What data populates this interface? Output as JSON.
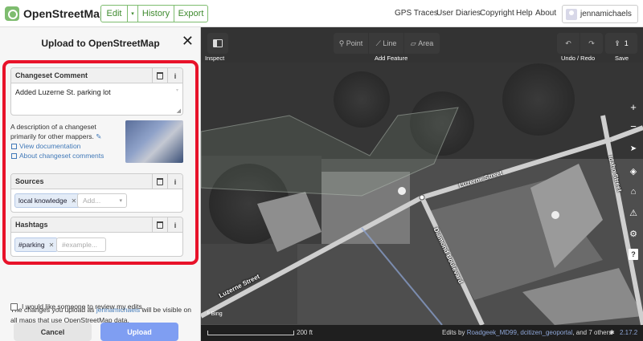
{
  "topbar": {
    "app_name": "OpenStreetMap",
    "edit_label": "Edit",
    "history_label": "History",
    "export_label": "Export",
    "nav": [
      "GPS Traces",
      "User Diaries",
      "Copyright",
      "Help",
      "About"
    ],
    "username": "jennamichaels"
  },
  "sidebar": {
    "title": "Upload to OpenStreetMap",
    "changeset_comment": {
      "label": "Changeset Comment",
      "value": "Added Luzerne St. parking lot"
    },
    "description": "A description of a changeset primarily for other mappers.",
    "links": [
      "View documentation",
      "About changeset comments"
    ],
    "sources": {
      "label": "Sources",
      "chips": [
        "local knowledge"
      ],
      "placeholder": "Add..."
    },
    "hashtags": {
      "label": "Hashtags",
      "chips": [
        "#parking"
      ],
      "placeholder": "#example..."
    },
    "notice_prefix": "The changes you upload as ",
    "notice_user": "jennamichaels",
    "notice_suffix": " will be visible on all maps that use OpenStreetMap data.",
    "review_label": "I would like someone to review my edits.",
    "cancel_label": "Cancel",
    "upload_label": "Upload"
  },
  "map": {
    "inspect_label": "Inspect",
    "point_label": "Point",
    "line_label": "Line",
    "area_label": "Area",
    "add_feature_label": "Add Feature",
    "undo_redo_label": "Undo / Redo",
    "save_label": "Save",
    "save_count": "1",
    "streets": [
      "Luzerne Street",
      "Luzerne Street",
      "Diamond Boulevard",
      "Idaho Street"
    ],
    "imagery_label": "Bing",
    "scale_label": "200 ft",
    "edits_prefix": "Edits by ",
    "edits_users": "Roadgeek_MD99, dcitizen_geoportal",
    "edits_suffix": ", and 7 others",
    "version": "2.17.2"
  },
  "colors": {
    "osm_green": "#7ebc6f",
    "highlight_red": "#e8122a",
    "link_blue": "#4179b8",
    "upload_blue": "#7f9ef2"
  }
}
